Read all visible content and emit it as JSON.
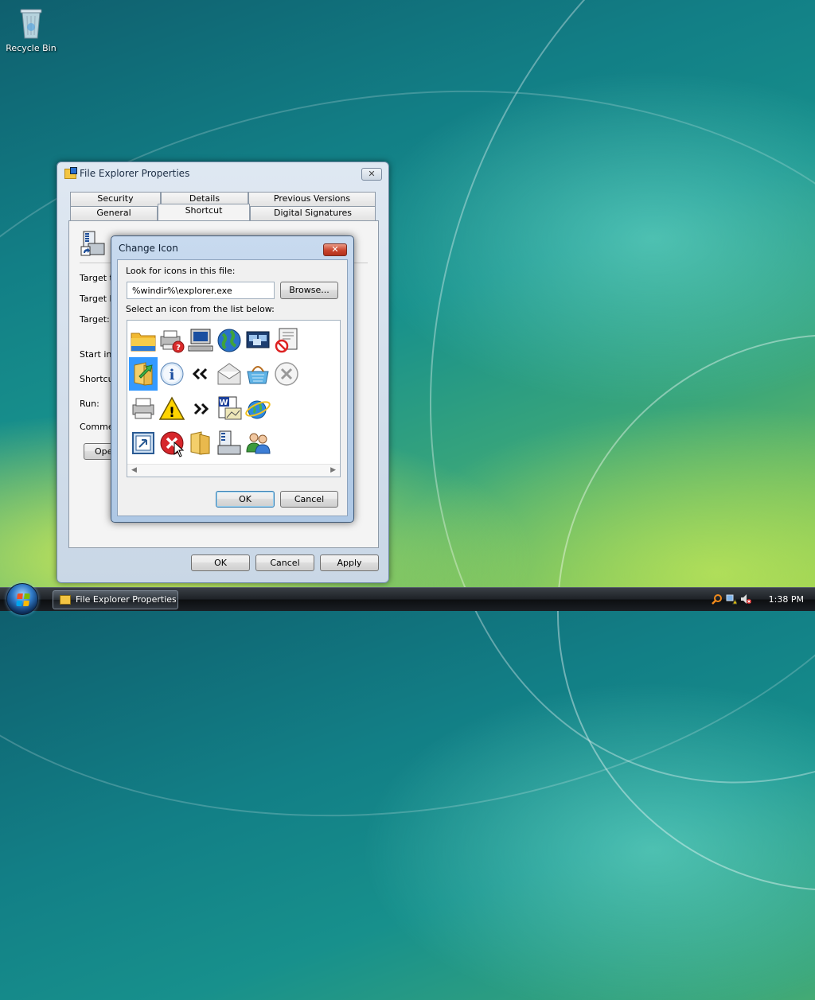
{
  "desktop": {
    "recycle_bin_label": "Recycle Bin"
  },
  "window": {
    "title": "File Explorer Properties",
    "close_glyph": "✕",
    "tabs_row1": [
      "Security",
      "Details",
      "Previous Versions"
    ],
    "tabs_row2": [
      "General",
      "Shortcut",
      "Digital Signatures"
    ],
    "active_tab": "Shortcut",
    "field_labels": {
      "target_type": "Target ty",
      "target_location": "Target lo",
      "target": "Target:",
      "start_in": "Start in:",
      "shortcut_key": "Shortcut",
      "run": "Run:",
      "comment": "Commen"
    },
    "open_button": "Open",
    "ok_button": "OK",
    "cancel_button": "Cancel",
    "apply_button": "Apply"
  },
  "dialog": {
    "title": "Change Icon",
    "close_glyph": "✕",
    "look_label": "Look for icons in this file:",
    "path_value": "%windir%\\explorer.exe",
    "browse_button": "Browse...",
    "select_label": "Select an icon from the list below:",
    "ok_button": "OK",
    "cancel_button": "Cancel",
    "icons": [
      [
        "folder-icon",
        "printer-help-icon",
        "computer-icon",
        "globe-icon",
        "network-window-icon",
        "no-access-document-icon"
      ],
      [
        "folder-arrow-icon",
        "info-icon",
        "double-chevron-left-icon",
        "mail-icon",
        "basket-icon",
        "cancel-circle-icon"
      ],
      [
        "printer-icon",
        "warning-icon",
        "double-chevron-right-icon",
        "word-document-icon",
        "internet-icon"
      ],
      [
        "window-arrow-icon",
        "error-icon",
        "folder-open-icon",
        "server-icon",
        "users-icon"
      ]
    ],
    "selected_icon": "folder-arrow-icon"
  },
  "taskbar": {
    "active_task": "File Explorer Properties",
    "clock": "1:38 PM"
  }
}
